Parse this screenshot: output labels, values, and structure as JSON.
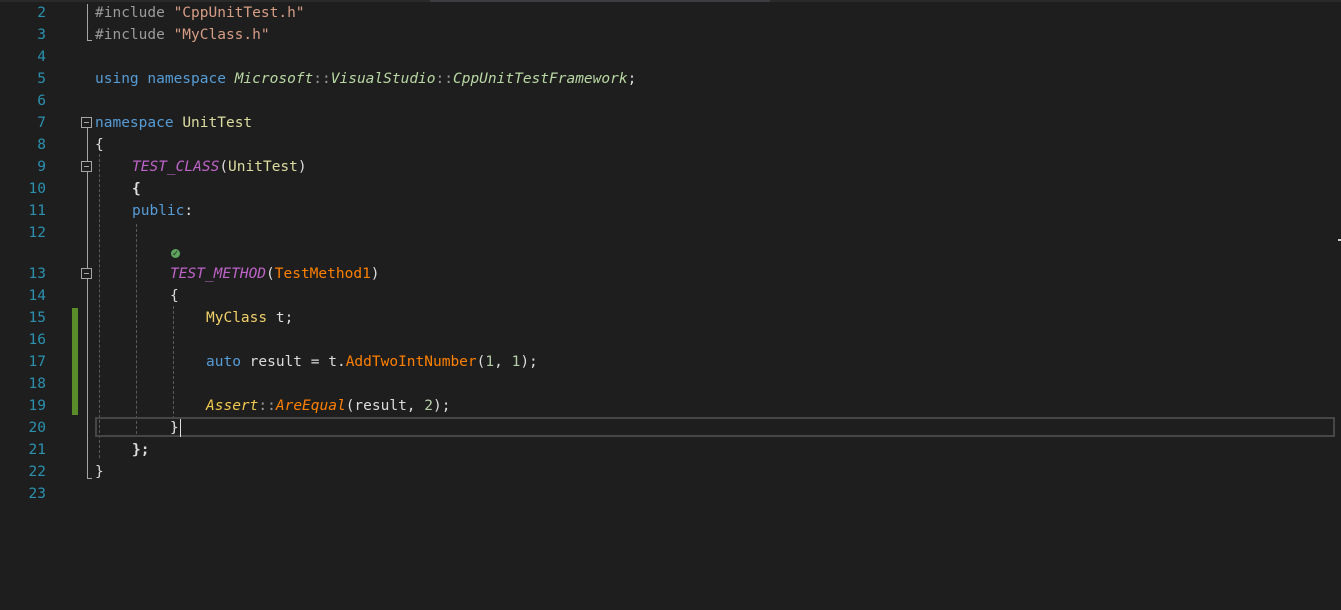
{
  "editor": {
    "line_numbers": [
      "2",
      "3",
      "4",
      "5",
      "6",
      "7",
      "8",
      "9",
      "10",
      "11",
      "12",
      "13",
      "14",
      "15",
      "16",
      "17",
      "18",
      "19",
      "20",
      "21",
      "22",
      "23"
    ],
    "code": {
      "include1": {
        "directive": "#include ",
        "file": "\"CppUnitTest.h\""
      },
      "include2": {
        "directive": "#include ",
        "file": "\"MyClass.h\""
      },
      "using": {
        "kw1": "using",
        "kw2": "namespace",
        "ns1": "Microsoft",
        "sep1": "::",
        "ns2": "VisualStudio",
        "sep2": "::",
        "ns3": "CppUnitTestFramework",
        "semi": ";"
      },
      "ns_decl": {
        "kw": "namespace",
        "name": "UnitTest"
      },
      "open_brace_ns": "{",
      "test_class": {
        "macro": "TEST_CLASS",
        "open": "(",
        "name": "UnitTest",
        "close": ")"
      },
      "open_brace_class": "{",
      "public": {
        "kw": "public",
        "colon": ":"
      },
      "test_method": {
        "macro": "TEST_METHOD",
        "open": "(",
        "name": "TestMethod1",
        "close": ")"
      },
      "open_brace_method": "{",
      "decl": {
        "type": "MyClass",
        "rest": " t;"
      },
      "auto_line": {
        "kw": "auto",
        "a": " result = t.",
        "fn": "AddTwoIntNumber",
        "b": "(",
        "n1": "1",
        "c": ", ",
        "n2": "1",
        "d": ");"
      },
      "assert_line": {
        "cls": "Assert",
        "sep": "::",
        "fn": "AreEqual",
        "a": "(result, ",
        "n": "2",
        "b": ");"
      },
      "close_brace_method": "}",
      "close_class": {
        "brace": "}",
        "semi": ";"
      },
      "close_brace_ns": "}"
    },
    "codelens_icon": "check-circle-icon",
    "colors": {
      "background": "#1e1e1e",
      "line_number": "#2b91af",
      "keyword": "#569cd6",
      "string": "#d69d85",
      "macro": "#be63c8",
      "function": "#ff8000",
      "change_bar": "#5b8c2a"
    }
  }
}
